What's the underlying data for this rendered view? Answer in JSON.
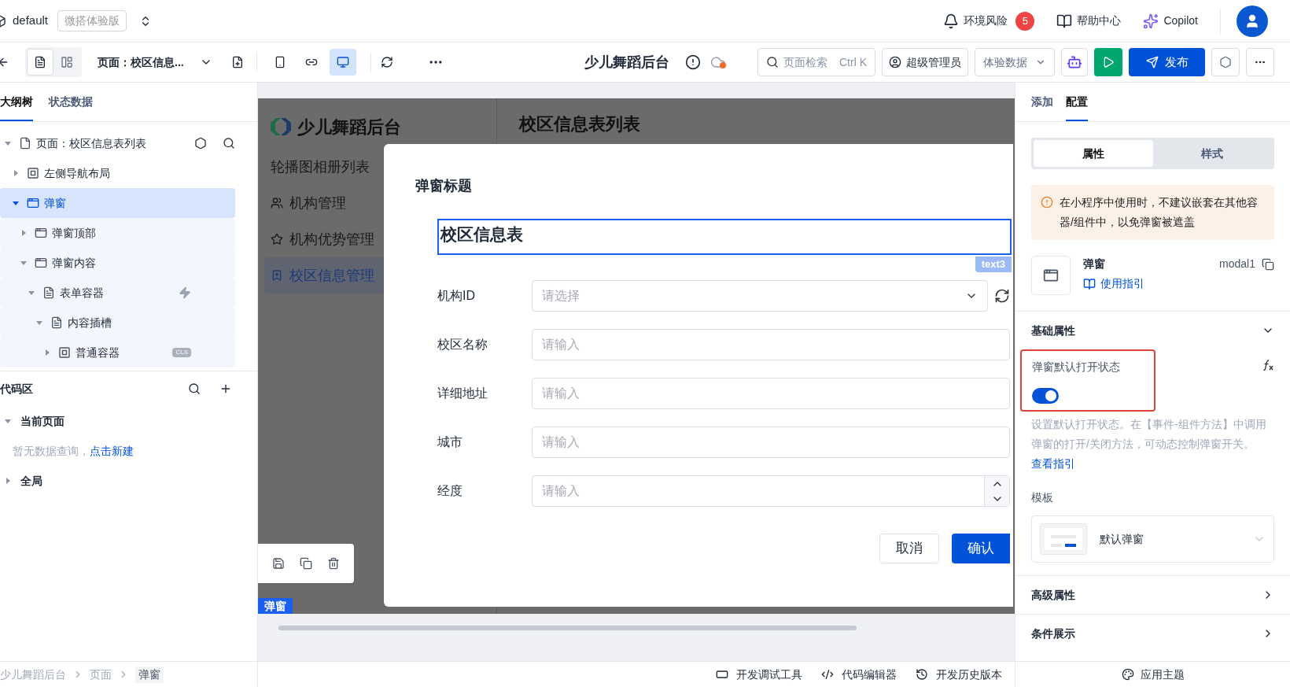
{
  "topbar": {
    "env": "default",
    "edition": "微搭体验版",
    "links": [
      {
        "kind": "bell",
        "label": "环境风险",
        "badge": "5"
      },
      {
        "kind": "book",
        "label": "帮助中心"
      },
      {
        "kind": "copilot",
        "label": "Copilot"
      }
    ]
  },
  "toolbar": {
    "views": [
      {
        "kind": "outline",
        "selected": true
      },
      {
        "kind": "layout",
        "selected": false
      }
    ],
    "page_select": "页面：校区信息...",
    "devices": [
      {
        "kind": "phone",
        "selected": false
      },
      {
        "kind": "miniapp",
        "selected": false
      },
      {
        "kind": "desktop",
        "selected": true
      }
    ],
    "app_title": "少儿舞蹈后台",
    "search": {
      "placeholder": "页面检索",
      "shortcut": "Ctrl K"
    },
    "role": "超级管理员",
    "data_select": "体验数据",
    "publish": "发布"
  },
  "left_panel": {
    "tabs": [
      {
        "label": "大纲树",
        "selected": true
      },
      {
        "label": "状态数据",
        "selected": false
      }
    ],
    "tree": [
      {
        "label": "页面：校区信息表列表",
        "kind": "page",
        "expanded": true,
        "selected": false,
        "children": [
          {
            "label": "左侧导航布局",
            "kind": "container",
            "expanded": false,
            "selected": false
          },
          {
            "label": "弹窗",
            "kind": "modal",
            "expanded": true,
            "selected": true,
            "children": [
              {
                "label": "弹窗顶部",
                "kind": "modal",
                "expanded": false,
                "selected": false
              },
              {
                "label": "弹窗内容",
                "kind": "modal",
                "expanded": true,
                "selected": false,
                "children": [
                  {
                    "label": "表单容器",
                    "kind": "form",
                    "expanded": true,
                    "selected": false,
                    "event": true,
                    "children": [
                      {
                        "label": "内容插槽",
                        "kind": "form",
                        "expanded": true,
                        "selected": false,
                        "children": [
                          {
                            "label": "普通容器",
                            "kind": "container",
                            "expanded": false,
                            "selected": false,
                            "badge": "CLS"
                          }
                        ]
                      }
                    ]
                  }
                ]
              }
            ]
          }
        ]
      }
    ],
    "code_area": {
      "title": "代码区",
      "groups": [
        {
          "label": "当前页面",
          "expanded": true,
          "empty_text": "暂无数据查询，",
          "empty_link": "点击新建"
        },
        {
          "label": "全局",
          "expanded": false
        }
      ]
    },
    "breadcrumb": [
      "少儿舞蹈后台",
      "页面",
      "弹窗"
    ]
  },
  "canvas": {
    "app_name": "少儿舞蹈后台",
    "page_title": "校区信息表列表",
    "nav": [
      {
        "label": "轮播图相册列表",
        "kind": "none",
        "selected": false
      },
      {
        "label": "机构管理",
        "kind": "org",
        "selected": false
      },
      {
        "label": "机构优势管理",
        "kind": "star",
        "selected": false
      },
      {
        "label": "校区信息管理",
        "kind": "bookmark",
        "selected": true
      }
    ],
    "modal": {
      "title": "弹窗标题",
      "heading": "校区信息表",
      "heading_tag": "text3",
      "fields": [
        {
          "label": "机构ID",
          "kind": "select",
          "placeholder": "请选择"
        },
        {
          "label": "校区名称",
          "kind": "input",
          "placeholder": "请输入"
        },
        {
          "label": "详细地址",
          "kind": "input",
          "placeholder": "请输入"
        },
        {
          "label": "城市",
          "kind": "input",
          "placeholder": "请输入"
        },
        {
          "label": "经度",
          "kind": "number",
          "placeholder": "请输入"
        }
      ],
      "cancel": "取消",
      "confirm": "确认"
    },
    "selection_tag": "弹窗"
  },
  "bottom_tools": [
    {
      "kind": "debug",
      "label": "开发调试工具"
    },
    {
      "kind": "code",
      "label": "代码编辑器"
    },
    {
      "kind": "history",
      "label": "开发历史版本"
    }
  ],
  "right_panel": {
    "tabs": [
      {
        "label": "添加",
        "selected": false
      },
      {
        "label": "配置",
        "selected": true
      }
    ],
    "segments": [
      {
        "label": "属性",
        "selected": true
      },
      {
        "label": "样式",
        "selected": false
      }
    ],
    "warning": "在小程序中使用时，不建议嵌套在其他容器/组件中，以免弹窗被遮盖",
    "component": {
      "name": "弹窗",
      "guide": "使用指引",
      "id": "modal1"
    },
    "sections": [
      {
        "title": "基础属性",
        "expanded": true
      },
      {
        "title": "高级属性",
        "expanded": false
      },
      {
        "title": "条件展示",
        "expanded": false
      }
    ],
    "prop": {
      "label": "弹窗默认打开状态",
      "on": true,
      "highlighted": true,
      "help": "设置默认打开状态。在【事件-组件方法】中调用弹窗的打开/关闭方法，可动态控制弹窗开关。",
      "help_link": "查看指引"
    },
    "template": {
      "label": "模板",
      "value": "默认弹窗"
    },
    "theme": "应用主题"
  }
}
